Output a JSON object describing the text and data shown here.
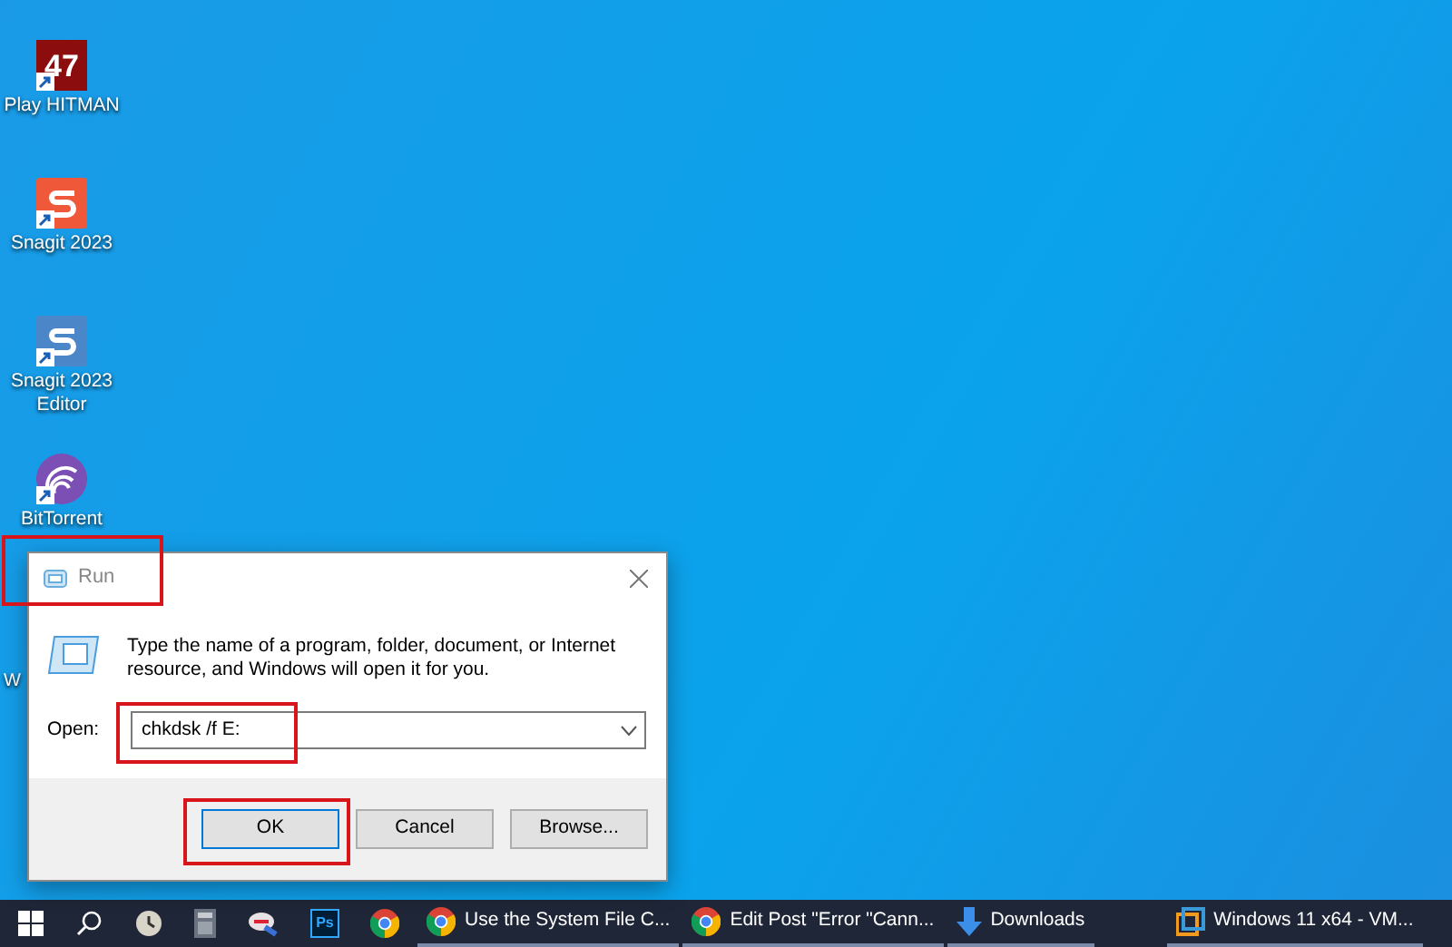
{
  "desktop_icons": [
    {
      "kind": "hitman",
      "label": "Play HITMAN",
      "glyph": "47"
    },
    {
      "kind": "snagit",
      "label": "Snagit 2023"
    },
    {
      "kind": "snagit_editor",
      "label": "Snagit 2023 Editor"
    },
    {
      "kind": "bittorrent",
      "label": "BitTorrent"
    }
  ],
  "hidden_icon_label": "W",
  "run_dialog": {
    "title": "Run",
    "description": "Type the name of a program, folder, document, or Internet resource, and Windows will open it for you.",
    "open_label": "Open:",
    "open_value": "chkdsk /f E:",
    "buttons": [
      {
        "label": "OK",
        "default": true
      },
      {
        "label": "Cancel",
        "default": false
      },
      {
        "label": "Browse...",
        "default": false
      }
    ]
  },
  "taskbar": {
    "pinned": [
      {
        "kind": "clock"
      },
      {
        "kind": "calculator"
      },
      {
        "kind": "tool"
      },
      {
        "kind": "photoshop",
        "glyph": "Ps"
      },
      {
        "kind": "chrome"
      }
    ],
    "tasks": [
      {
        "kind": "chrome",
        "label": "Use the System File C..."
      },
      {
        "kind": "chrome",
        "label": "Edit Post \"Error \"Cann..."
      },
      {
        "kind": "download",
        "label": "Downloads"
      },
      {
        "kind": "vm",
        "label": "Windows 11 x64 - VM..."
      }
    ]
  }
}
